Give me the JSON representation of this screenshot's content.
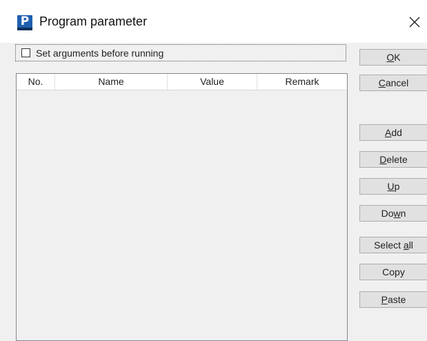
{
  "window": {
    "title": "Program parameter"
  },
  "icons": {
    "app_letter": "P",
    "close": "close-icon"
  },
  "checkbox": {
    "label": "Set arguments before running",
    "checked": false
  },
  "table": {
    "columns": [
      "No.",
      "Name",
      "Value",
      "Remark"
    ],
    "rows": []
  },
  "buttons": {
    "ok": {
      "pre": "",
      "key": "O",
      "post": "K"
    },
    "cancel": {
      "pre": "",
      "key": "C",
      "post": "ancel"
    },
    "add": {
      "pre": "",
      "key": "A",
      "post": "dd"
    },
    "delete": {
      "pre": "",
      "key": "D",
      "post": "elete"
    },
    "up": {
      "pre": "",
      "key": "U",
      "post": "p"
    },
    "down": {
      "pre": "Do",
      "key": "w",
      "post": "n"
    },
    "select_all": {
      "pre": "Select ",
      "key": "a",
      "post": "ll"
    },
    "copy": {
      "pre": "Copy",
      "key": "",
      "post": ""
    },
    "paste": {
      "pre": "",
      "key": "P",
      "post": "aste"
    }
  }
}
